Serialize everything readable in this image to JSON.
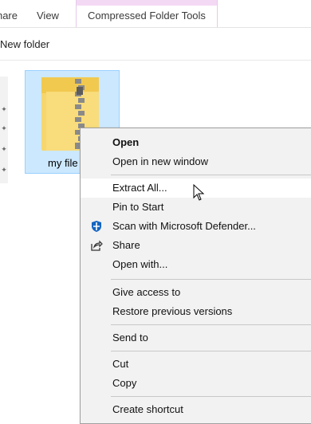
{
  "ribbon": {
    "tabs": [
      {
        "label": "Share"
      },
      {
        "label": "View"
      },
      {
        "label": "Compressed Folder Tools"
      }
    ],
    "context_tab_color": "#f4d9f5"
  },
  "toolbar": {
    "new_folder_label": "New folder"
  },
  "file": {
    "name": "my file",
    "icon": "zip-folder-icon",
    "selected_bg": "#cce8ff"
  },
  "context_menu": {
    "items": [
      {
        "label": "Open",
        "bold": true
      },
      {
        "label": "Open in new window"
      },
      {
        "label": "Extract All...",
        "hovered": true
      },
      {
        "label": "Pin to Start"
      },
      {
        "label": "Scan with Microsoft Defender...",
        "icon": "defender-shield-icon"
      },
      {
        "label": "Share",
        "icon": "share-icon"
      },
      {
        "label": "Open with..."
      },
      {
        "label": "Give access to"
      },
      {
        "label": "Restore previous versions"
      },
      {
        "label": "Send to"
      },
      {
        "label": "Cut"
      },
      {
        "label": "Copy"
      },
      {
        "label": "Create shortcut"
      }
    ]
  }
}
